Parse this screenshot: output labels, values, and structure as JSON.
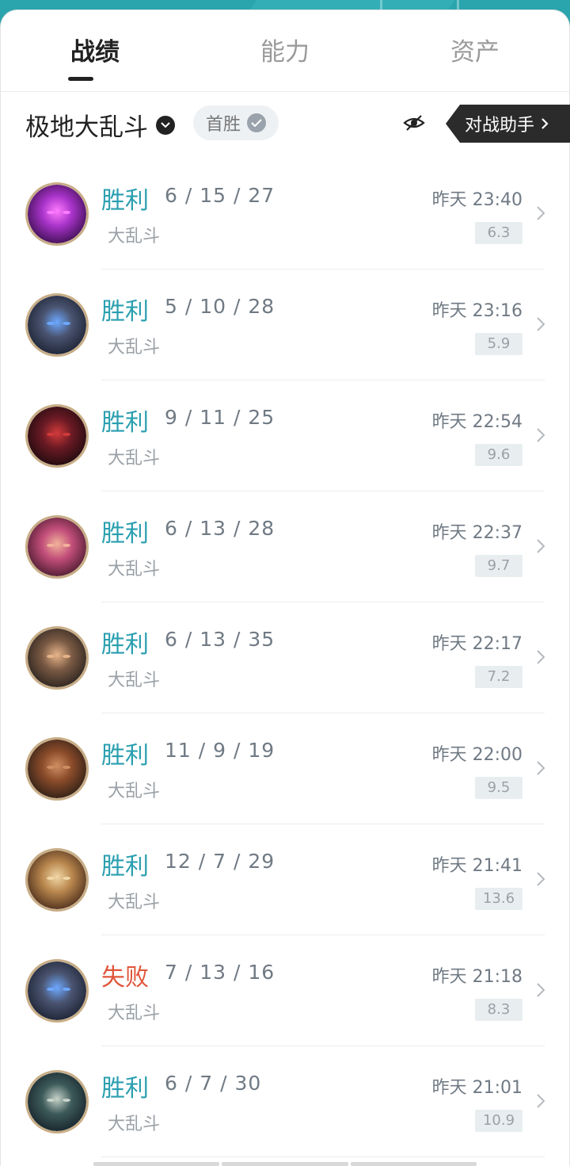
{
  "colors": {
    "accent": "#2a9fb0",
    "win": "#2a9fb0",
    "lose": "#e0553a",
    "header": "#2aa4ad",
    "assistant_bg": "#2b2b2b"
  },
  "tabs": [
    {
      "label": "战绩",
      "active": true
    },
    {
      "label": "能力",
      "active": false
    },
    {
      "label": "资产",
      "active": false
    }
  ],
  "filter": {
    "mode": "极地大乱斗",
    "first_win_chip": "首胜",
    "assistant_label": "对战助手",
    "hide_icon": "eye-off-icon"
  },
  "matches": [
    {
      "result": "胜利",
      "outcome": "win",
      "kda": "6 / 15 / 27",
      "mode": "大乱斗",
      "time": "昨天 23:40",
      "score": "6.3",
      "avatar_colors": [
        "#3a0f4e",
        "#a833c9",
        "#ff7bff"
      ]
    },
    {
      "result": "胜利",
      "outcome": "win",
      "kda": "5 / 10 / 28",
      "mode": "大乱斗",
      "time": "昨天 23:16",
      "score": "5.9",
      "avatar_colors": [
        "#1c2233",
        "#4a5470",
        "#6da8ff"
      ]
    },
    {
      "result": "胜利",
      "outcome": "win",
      "kda": "9 / 11 / 25",
      "mode": "大乱斗",
      "time": "昨天 22:54",
      "score": "9.6",
      "avatar_colors": [
        "#1d0b0e",
        "#6a1a24",
        "#d23a3a"
      ]
    },
    {
      "result": "胜利",
      "outcome": "win",
      "kda": "6 / 13 / 28",
      "mode": "大乱斗",
      "time": "昨天 22:37",
      "score": "9.7",
      "avatar_colors": [
        "#4a1a2e",
        "#c24e7a",
        "#f2b29a"
      ]
    },
    {
      "result": "胜利",
      "outcome": "win",
      "kda": "6 / 13 / 35",
      "mode": "大乱斗",
      "time": "昨天 22:17",
      "score": "7.2",
      "avatar_colors": [
        "#2a221e",
        "#7a5a44",
        "#e7b48a"
      ]
    },
    {
      "result": "胜利",
      "outcome": "win",
      "kda": "11 / 9 / 19",
      "mode": "大乱斗",
      "time": "昨天 22:00",
      "score": "9.5",
      "avatar_colors": [
        "#2d1f16",
        "#8a4b2a",
        "#cf8e62"
      ]
    },
    {
      "result": "胜利",
      "outcome": "win",
      "kda": "12 / 7 / 29",
      "mode": "大乱斗",
      "time": "昨天 21:41",
      "score": "13.6",
      "avatar_colors": [
        "#4a2c1a",
        "#b9874e",
        "#f0d7a6"
      ]
    },
    {
      "result": "失败",
      "outcome": "lose",
      "kda": "7 / 13 / 16",
      "mode": "大乱斗",
      "time": "昨天 21:18",
      "score": "8.3",
      "avatar_colors": [
        "#1c2233",
        "#4a5470",
        "#6da8ff"
      ]
    },
    {
      "result": "胜利",
      "outcome": "win",
      "kda": "6 / 7 / 30",
      "mode": "大乱斗",
      "time": "昨天 21:01",
      "score": "10.9",
      "avatar_colors": [
        "#16232a",
        "#3d5a5a",
        "#c6d2c9"
      ]
    }
  ]
}
